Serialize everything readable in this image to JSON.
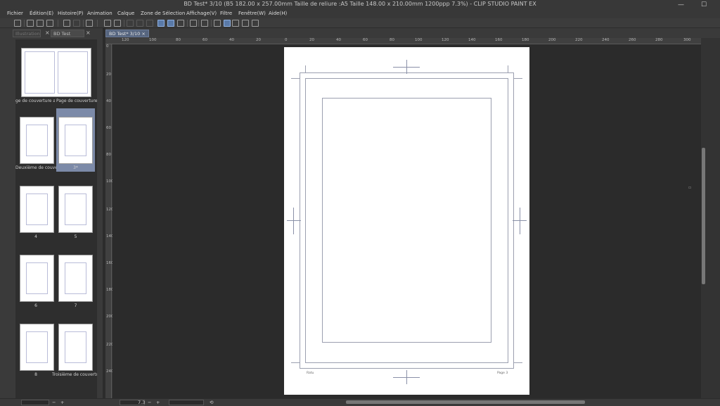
{
  "window": {
    "title": "BD Test* 3/10 (B5 182.00 x 257.00mm Taille de reliure :A5 Taille 148.00 x 210.00mm 1200ppp 7.3%) - CLIP STUDIO PAINT EX",
    "minimize": "—",
    "maximize": "☐"
  },
  "menu": [
    "Fichier",
    "Édition(E)",
    "Histoire(P)",
    "Animation",
    "Calque",
    "Zone de Sélection",
    "Affichage(V)",
    "Filtre",
    "Fenêtre(W)",
    "Aide(H)"
  ],
  "left_panel": {
    "tabs": [
      "Illustration",
      "BD Test"
    ],
    "close_icon": "×",
    "spreads": [
      {
        "labels": [
          "ge de couverture arriè",
          "Page de couverture"
        ]
      },
      {
        "labels": [
          "Deuxième de couvertu",
          "3*"
        ],
        "selected_right": true
      },
      {
        "labels": [
          "4",
          "5"
        ]
      },
      {
        "labels": [
          "6",
          "7"
        ]
      },
      {
        "labels": [
          "8",
          "Troisième de couvertur"
        ]
      }
    ]
  },
  "document_tab": {
    "label": "BD Test* 3/10",
    "close": "×"
  },
  "ruler": {
    "h_labels": [
      "120",
      "100",
      "80",
      "60",
      "40",
      "20",
      "0",
      "20",
      "40",
      "60",
      "80",
      "100",
      "120",
      "140",
      "160",
      "180",
      "200",
      "220",
      "240",
      "260",
      "280",
      "300"
    ],
    "v_labels": [
      "0",
      "20",
      "40",
      "60",
      "80",
      "100",
      "120",
      "140",
      "160",
      "180",
      "200",
      "220",
      "240"
    ]
  },
  "page": {
    "footer_left": "Ratu",
    "footer_right": "Page 3"
  },
  "status": {
    "zoom": "7.3",
    "minus": "−",
    "plus": "+",
    "reset": "⟲"
  },
  "colors": {
    "accent": "#5a7aa8",
    "selected_thumb": "#7c8aa8",
    "canvas_bg": "#2b2b2b",
    "panel_bg": "#3a3a3a"
  }
}
